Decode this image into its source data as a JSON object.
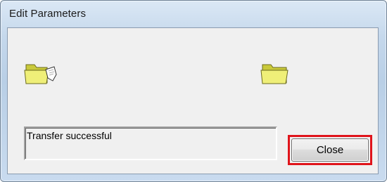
{
  "window": {
    "title": "Edit Parameters"
  },
  "icons": {
    "left": "folder-with-document-icon",
    "right": "folder-icon",
    "folder_color": "#e8e86a"
  },
  "status": {
    "text": "Transfer successful"
  },
  "buttons": {
    "close_label": "Close",
    "highlight_color": "#e0141b"
  }
}
